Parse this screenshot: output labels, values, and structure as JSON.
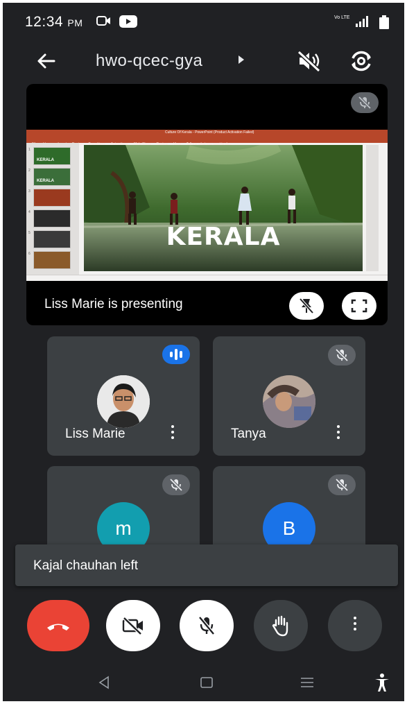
{
  "status_bar": {
    "time": "12:34",
    "ampm": "PM",
    "net": "Vo LTE"
  },
  "meeting": {
    "code": "hwo-qcec-gya"
  },
  "presentation": {
    "caption": "Liss Marie is presenting",
    "window_title": "Culture Of Kerala - PowerPoint (Product Activation Failed)",
    "ribbon_tabs": [
      "File",
      "Home",
      "Insert",
      "Design",
      "Transitions",
      "Animations",
      "Slide Show",
      "Review",
      "View",
      "Tell me what you want to do..."
    ],
    "slide_title": "KERALA",
    "thumbnails": [
      {
        "num": "1",
        "label": "KERALA",
        "color": "#2e6b2a"
      },
      {
        "num": "2",
        "label": "KERALA",
        "color": "#3b6e3a"
      },
      {
        "num": "3",
        "label": "",
        "color": "#9a3a1f"
      },
      {
        "num": "4",
        "label": "",
        "color": "#2b2b2b"
      },
      {
        "num": "5",
        "label": "",
        "color": "#3a3a3a"
      },
      {
        "num": "6",
        "label": "",
        "color": "#8a5a2a"
      }
    ]
  },
  "participants": [
    {
      "name": "Liss Marie",
      "speaking": true
    },
    {
      "name": "Tanya",
      "speaking": false
    },
    {
      "initial": "m",
      "color": "#129eaf"
    },
    {
      "initial": "B",
      "color": "#1a73e8"
    }
  ],
  "toast": {
    "text": "Kajal chauhan left"
  },
  "colors": {
    "background": "#202124",
    "tile": "#3c4043",
    "end_call": "#ea4335",
    "accent": "#1a73e8"
  },
  "icons": {
    "back": "arrow-left-icon",
    "audio": "speaker-off-icon",
    "camera_switch": "camera-switch-icon",
    "end_call": "phone-hangup-icon",
    "camera": "camera-off-icon",
    "mic": "mic-off-icon",
    "raise_hand": "hand-icon",
    "more": "more-vert-icon",
    "accessibility": "accessibility-icon"
  }
}
